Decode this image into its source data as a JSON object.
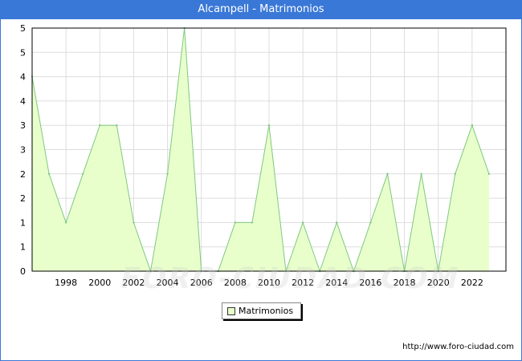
{
  "chart_data": {
    "type": "area",
    "title": "Alcampell - Matrimonios",
    "xlabel": "",
    "ylabel": "",
    "x": [
      1996,
      1997,
      1998,
      1999,
      2000,
      2001,
      2002,
      2003,
      2004,
      2005,
      2006,
      2007,
      2008,
      2009,
      2010,
      2011,
      2012,
      2013,
      2014,
      2015,
      2016,
      2017,
      2018,
      2019,
      2020,
      2021,
      2022,
      2023
    ],
    "series": [
      {
        "name": "Matrimonios",
        "values": [
          4,
          2,
          1,
          2,
          3,
          3,
          1,
          0,
          2,
          5,
          0,
          0,
          1,
          1,
          3,
          0,
          1,
          0,
          1,
          0,
          1,
          2,
          0,
          2,
          0,
          2,
          3,
          2
        ]
      }
    ],
    "xticks": [
      1998,
      2000,
      2002,
      2004,
      2006,
      2008,
      2010,
      2012,
      2014,
      2016,
      2018,
      2020,
      2022
    ],
    "ytick_labels": [
      "0",
      "1",
      "1",
      "2",
      "2",
      "3",
      "3",
      "4",
      "4",
      "5",
      "5"
    ],
    "ylim": [
      0,
      5
    ],
    "grid": true,
    "legend": "bottom-center",
    "colors": {
      "fill": "#e8ffcc",
      "line": "#7fc87f",
      "grid": "#dddddd",
      "header": "#3a78d8"
    }
  },
  "watermark": "FORO-CIUDAD.COM",
  "source_url": "http://www.foro-ciudad.com"
}
